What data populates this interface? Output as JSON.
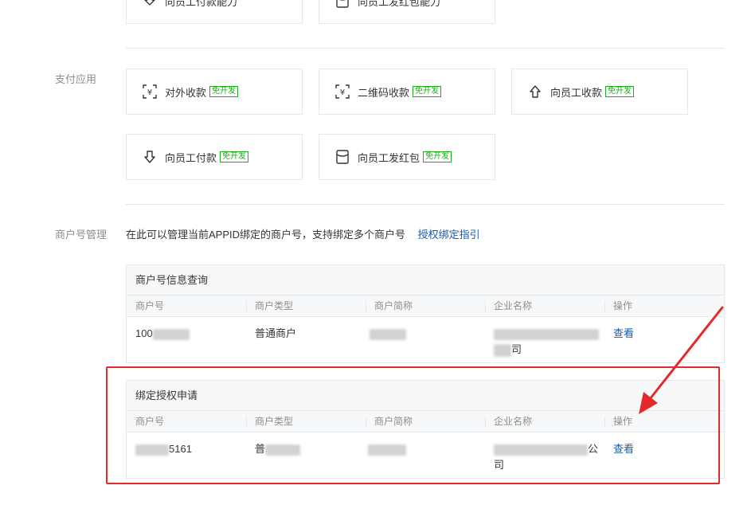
{
  "top_cards": [
    {
      "label": "向员工付款能力",
      "icon": "pay-down-icon"
    },
    {
      "label": "向员工发红包能力",
      "icon": "redpacket-icon"
    }
  ],
  "pay_apps": {
    "label": "支付应用",
    "tag": "免开发",
    "cards": [
      {
        "label": "对外收款",
        "icon": "scan-yuan-icon"
      },
      {
        "label": "二维码收款",
        "icon": "qrcode-yuan-icon"
      },
      {
        "label": "向员工收款",
        "icon": "receive-up-icon"
      },
      {
        "label": "向员工付款",
        "icon": "pay-down-icon"
      },
      {
        "label": "向员工发红包",
        "icon": "redpacket-icon"
      }
    ]
  },
  "merchant": {
    "label": "商户号管理",
    "desc": "在此可以管理当前APPID绑定的商户号，支持绑定多个商户号",
    "guide_link": "授权绑定指引",
    "columns": [
      "商户号",
      "商户类型",
      "商户简称",
      "企业名称",
      "操作"
    ],
    "info_panel": {
      "title": "商户号信息查询",
      "row": {
        "id": "100",
        "type": "普通商户",
        "company_suffix": "司",
        "action": "查看"
      }
    },
    "bind_panel": {
      "title": "绑定授权申请",
      "row": {
        "id": "5161",
        "type": "普",
        "company_suffix": "公",
        "company_line2": "司",
        "action": "查看"
      }
    }
  },
  "colors": {
    "accent_green": "#1aad19",
    "link_blue": "#1e5aa8",
    "annotation_red": "#e32a2a"
  }
}
